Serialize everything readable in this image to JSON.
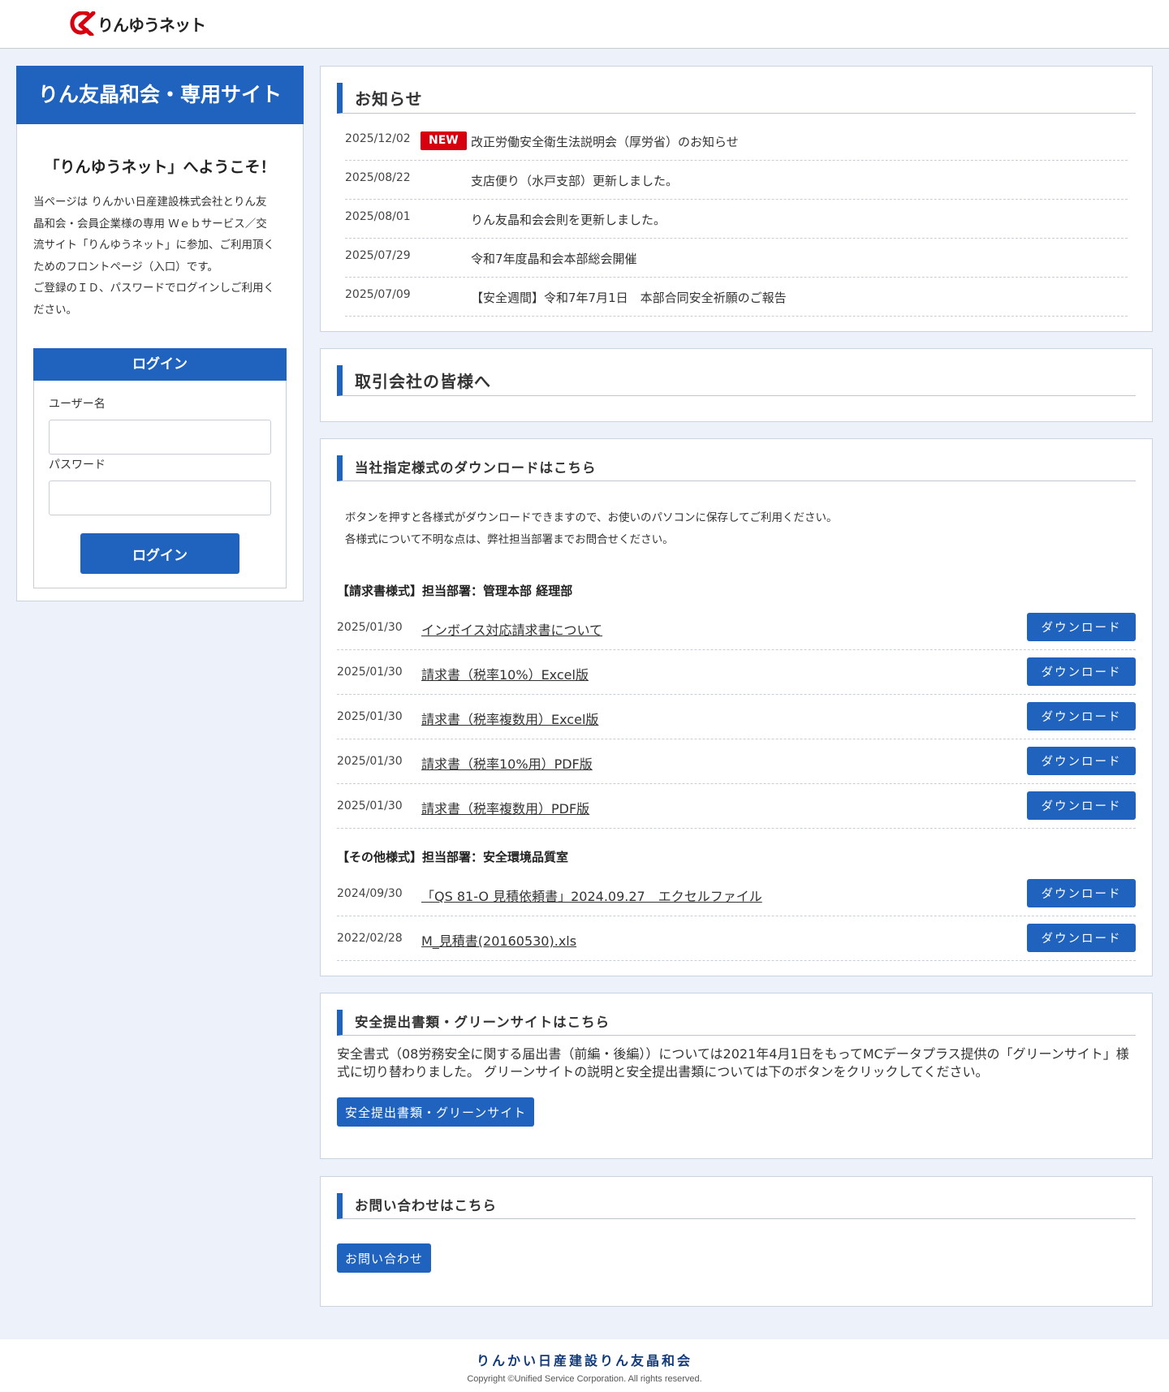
{
  "header": {
    "logo_text": "りんゆうネット"
  },
  "sidebar": {
    "title": "りん友晶和会・専用サイト",
    "welcome": "「りんゆうネット」へようこそ！",
    "intro_lines": [
      "当ページは りんかい日産建設株式会社とりん友",
      "晶和会・会員企業様の専用 Ｗｅｂサービス／交",
      "流サイト「りんゆうネット」に参加、ご利用頂く",
      "ためのフロントページ（入口）です。",
      "ご登録のＩＤ、パスワードでログインしご利用く",
      "ださい。"
    ],
    "login": {
      "heading": "ログイン",
      "username_label": "ユーザー名",
      "password_label": "パスワード",
      "username_value": "",
      "password_value": "",
      "button": "ログイン"
    }
  },
  "news": {
    "title": "お知らせ",
    "items": [
      {
        "date": "2025/12/02",
        "badge": "NEW",
        "text": "改正労働安全衛生法説明会（厚労省）のお知らせ"
      },
      {
        "date": "2025/08/22",
        "badge": "",
        "text": "支店便り（水戸支部）更新しました。"
      },
      {
        "date": "2025/08/01",
        "badge": "",
        "text": "りん友晶和会会則を更新しました。"
      },
      {
        "date": "2025/07/29",
        "badge": "",
        "text": "令和7年度晶和会本部総会開催"
      },
      {
        "date": "2025/07/09",
        "badge": "",
        "text": "【安全週間】令和7年7月1日　本部合同安全祈願のご報告"
      }
    ]
  },
  "partners": {
    "title": "取引会社の皆様へ"
  },
  "downloads": {
    "title": "当社指定様式のダウンロードはこちら",
    "desc_lines": [
      "ボタンを押すと各様式がダウンロードできますので、お使いのパソコンに保存してご利用ください。",
      "各様式について不明な点は、弊社担当部署までお問合せください。"
    ],
    "button_label": "ダウンロード",
    "sections": [
      {
        "heading": "【請求書様式】担当部署：管理本部 経理部",
        "items": [
          {
            "date": "2025/01/30",
            "name": "インボイス対応請求書について"
          },
          {
            "date": "2025/01/30",
            "name": "請求書（税率10%）Excel版"
          },
          {
            "date": "2025/01/30",
            "name": "請求書（税率複数用）Excel版"
          },
          {
            "date": "2025/01/30",
            "name": "請求書（税率10%用）PDF版"
          },
          {
            "date": "2025/01/30",
            "name": "請求書（税率複数用）PDF版"
          }
        ]
      },
      {
        "heading": "【その他様式】担当部署：安全環境品質室",
        "items": [
          {
            "date": "2024/09/30",
            "name": "「QS 81-O 見積依頼書」2024.09.27　エクセルファイル"
          },
          {
            "date": "2022/02/28",
            "name": "M_見積書(20160530).xls"
          }
        ]
      }
    ]
  },
  "green": {
    "title": "安全提出書類・グリーンサイトはこちら",
    "text": "安全書式（08労務安全に関する届出書（前編・後編））については2021年4月1日をもってMCデータプラス提供の「グリーンサイト」様式に切り替わりました。 グリーンサイトの説明と安全提出書類については下のボタンをクリックしてください。",
    "button": "安全提出書類・グリーンサイト"
  },
  "contact": {
    "title": "お問い合わせはこちら",
    "button": "お問い合わせ"
  },
  "footer": {
    "org": "りんかい日産建設りん友晶和会",
    "copyright": "Copyright ©Unified Service Corporation. All rights reserved."
  },
  "colors": {
    "accent": "#1f63bf",
    "new_badge": "#d6000f",
    "background": "#edf2fa",
    "logo_mark": "#d6000f"
  },
  "icons": {
    "logo": "rinkai-logo-icon"
  }
}
